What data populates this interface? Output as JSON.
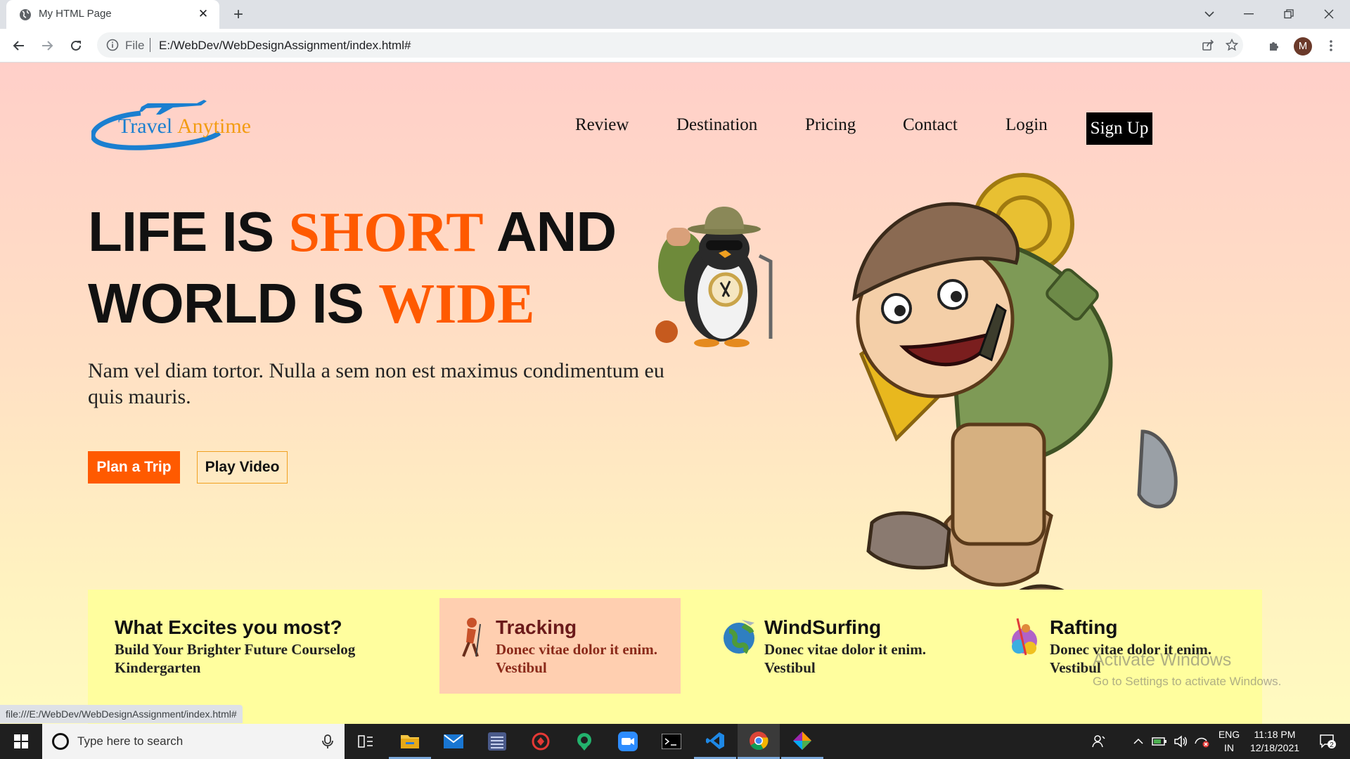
{
  "browser": {
    "tab_title": "My HTML Page",
    "url_scheme": "File",
    "url": "E:/WebDev/WebDesignAssignment/index.html#",
    "profile_initial": "M",
    "status_url": "file:///E:/WebDev/WebDesignAssignment/index.html#"
  },
  "site": {
    "logo": {
      "part1": "Travel",
      "part2": "Anytime"
    },
    "nav": {
      "review": "Review",
      "destination": "Destination",
      "pricing": "Pricing",
      "contact": "Contact",
      "login": "Login",
      "signup": "Sign Up"
    },
    "hero": {
      "line1_a": "LIFE IS ",
      "line1_accent": "SHORT",
      "line1_b": " AND",
      "line2_a": "WORLD IS ",
      "line2_accent": "WIDE",
      "subtitle": "Nam vel diam tortor. Nulla a sem non est maximus condimentum eu quis mauris.",
      "plan_button": "Plan a Trip",
      "video_button": "Play Video"
    },
    "features": {
      "intro_title": "What Excites you most?",
      "intro_text": "Build Your Brighter Future Courselog Kindergarten",
      "items": [
        {
          "title": "Tracking",
          "text": "Donec vitae dolor it enim. Vestibul",
          "icon": "hiker-icon"
        },
        {
          "title": "WindSurfing",
          "text": "Donec vitae dolor it enim. Vestibul",
          "icon": "globe-plane-icon"
        },
        {
          "title": "Rafting",
          "text": "Donec vitae dolor it enim. Vestibul",
          "icon": "rafting-icon"
        }
      ]
    }
  },
  "windows": {
    "watermark_title": "Activate Windows",
    "watermark_sub": "Go to Settings to activate Windows.",
    "search_placeholder": "Type here to search",
    "lang_top": "ENG",
    "lang_bottom": "IN",
    "time": "11:18 PM",
    "date": "12/18/2021",
    "notification_count": "2"
  },
  "colors": {
    "accent_orange": "#ff5a00",
    "logo_blue": "#1a7fd0",
    "logo_orange": "#f39c12",
    "feature_band": "#fffe9e",
    "feature_active": "#ffcfb0"
  }
}
